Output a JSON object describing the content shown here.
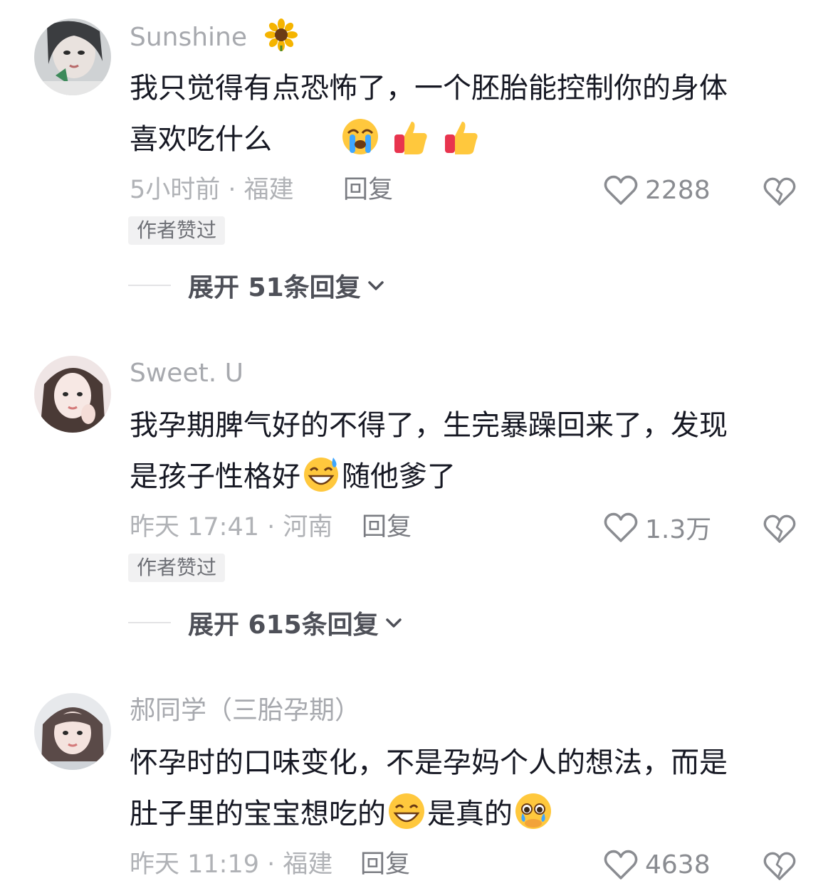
{
  "comments": [
    {
      "username": "Sunshine",
      "username_emoji": "sunflower-icon",
      "text_line1": "我只觉得有点恐怖了，一个胚胎能控制你的身体",
      "text_line2": "喜欢吃什么",
      "meta": "5小时前 · 福建",
      "reply_label": "回复",
      "like_count": "2288",
      "badge": "作者赞过",
      "expand_label": "展开 51条回复"
    },
    {
      "username": "Sweet. U",
      "text_line1": "我孕期脾气好的不得了，生完暴躁回来了，发现",
      "text_line2_a": "是孩子性格好",
      "text_line2_b": "随他爹了",
      "meta": "昨天 17:41 · 河南",
      "reply_label": "回复",
      "like_count": "1.3万",
      "badge": "作者赞过",
      "expand_label": "展开 615条回复"
    },
    {
      "username": "郝同学（三胎孕期）",
      "text_line1": "怀孕时的口味变化，不是孕妈个人的想法，而是",
      "text_line2_a": "肚子里的宝宝想吃的",
      "text_line2_b": "是真的",
      "meta": "昨天 11:19 · 福建",
      "reply_label": "回复",
      "like_count": "4638"
    }
  ],
  "colors": {
    "text": "#161823",
    "secondary": "#a7a9ae",
    "badge_bg": "#f1f1f2"
  }
}
